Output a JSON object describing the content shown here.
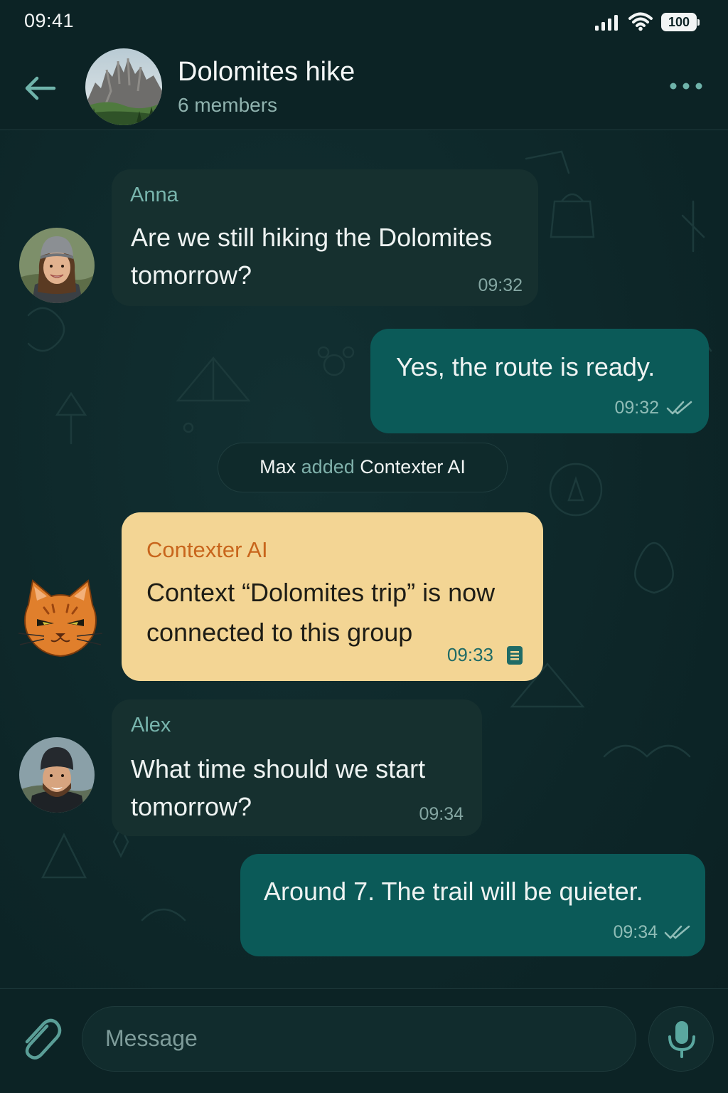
{
  "status_bar": {
    "time": "09:41",
    "battery": "100"
  },
  "header": {
    "title": "Dolomites hike",
    "subtitle": "6 members"
  },
  "messages": [
    {
      "sender": "Anna",
      "line1": "Are we still hiking the Dolomites",
      "line2": "tomorrow?",
      "time": "09:32"
    },
    {
      "line1": "Yes, the route is ready.",
      "time": "09:32"
    },
    {
      "sender": "Contexter AI",
      "line1": "Context “Dolomites trip” is now",
      "line2": "connected to this group",
      "time": "09:33"
    },
    {
      "sender": "Alex",
      "line1": "What time should we start",
      "line2": "tomorrow?",
      "time": "09:34"
    },
    {
      "line1": "Around 7. The trail will be quieter.",
      "time": "09:34"
    }
  ],
  "system_event": {
    "actor": "Max",
    "action": "added",
    "target": "Contexter AI"
  },
  "composer": {
    "placeholder": "Message"
  },
  "colors": {
    "background": "#0d2426",
    "incoming_bubble": "#16302f",
    "outgoing_bubble": "#0b5a58",
    "bot_bubble": "#f3d594",
    "accent": "#6fb3aa",
    "bot_name": "#c8651c"
  },
  "icons": {
    "back": "arrow-left-icon",
    "more": "more-dots-icon",
    "read": "double-check-icon",
    "context": "document-icon",
    "attach": "paperclip-icon",
    "mic": "microphone-icon"
  }
}
